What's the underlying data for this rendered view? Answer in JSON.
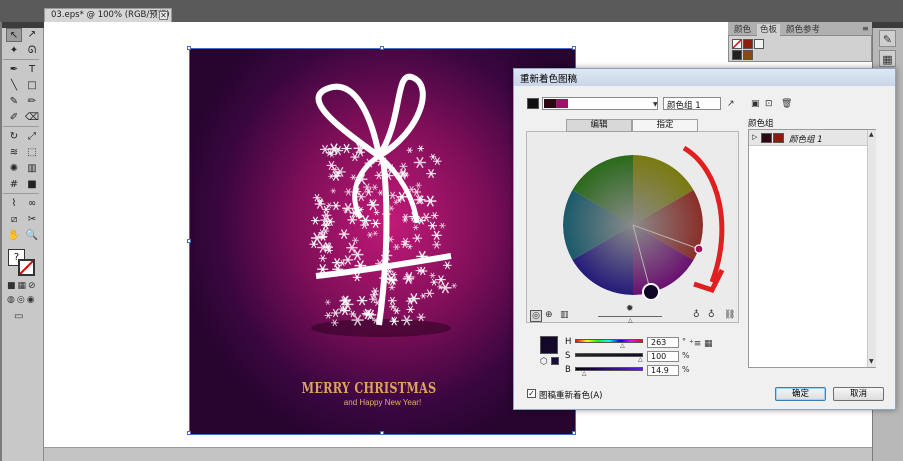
{
  "document": {
    "tab_title": "03.eps* @ 100% (RGB/预览)",
    "tab_close": "✕"
  },
  "panel": {
    "tabs": [
      "颜色",
      "色板",
      "颜色参考"
    ],
    "menu_icon": "≡",
    "swatches": [
      "#000000",
      "#8b1d0b",
      "#f2f2f2",
      "#222222",
      "#8b4a0b"
    ]
  },
  "artwork": {
    "title": "MERRY CHRISTMAS",
    "subtitle": "and Happy New Year!",
    "colors": {
      "bg_center": "#c21a78",
      "bg_edge": "#27052f",
      "text": "#d9a45b"
    }
  },
  "dialog": {
    "title": "重新着色图稿",
    "group_name_value": "颜色组 1",
    "tabs": {
      "edit": "编辑",
      "assign": "指定"
    },
    "groups_label": "颜色组",
    "groups": [
      {
        "name": "颜色组 1",
        "swatches": [
          "#2c0812",
          "#8b1d0b"
        ]
      }
    ],
    "hsb": [
      {
        "label": "H",
        "value": "263",
        "unit": "°",
        "fraction": 0.73,
        "track": "hue"
      },
      {
        "label": "S",
        "value": "100",
        "unit": "%",
        "fraction": 1.0,
        "track": "sat"
      },
      {
        "label": "B",
        "value": "14.9",
        "unit": "%",
        "fraction": 0.149,
        "track": "bri"
      }
    ],
    "current_color": "#14082a",
    "recolor_checkbox": {
      "checked": true,
      "label": "图稿重新着色(A)",
      "mark": "✓"
    },
    "ok": "确定",
    "cancel": "取消"
  },
  "icons": {
    "tools": [
      "selection-icon",
      "direct-selection-icon",
      "magic-wand-icon",
      "lasso-icon",
      "pen-icon",
      "type-icon",
      "line-icon",
      "rectangle-icon",
      "paintbrush-icon",
      "pencil-icon",
      "blob-brush-icon",
      "eraser-icon",
      "rotate-icon",
      "scale-icon",
      "warp-icon",
      "free-transform-icon",
      "symbol-sprayer-icon",
      "column-graph-icon",
      "mesh-icon",
      "gradient-icon",
      "eyedropper-icon",
      "blend-icon",
      "slice-icon",
      "scissors-icon",
      "hand-icon",
      "zoom-icon"
    ]
  }
}
